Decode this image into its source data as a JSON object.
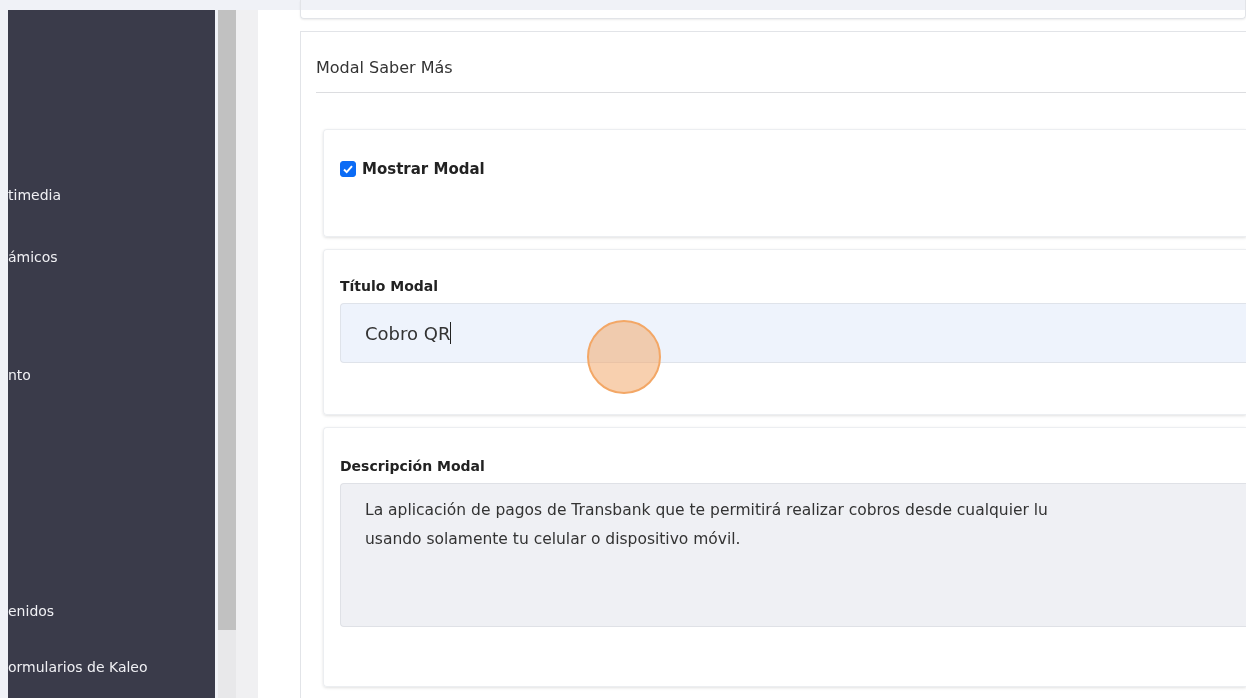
{
  "sidebar": {
    "items": [
      {
        "label": "timedia"
      },
      {
        "label": "ámicos"
      },
      {
        "label": "nto"
      },
      {
        "label": "enidos"
      },
      {
        "label": "ormularios de Kaleo"
      }
    ]
  },
  "section": {
    "title": "Modal Saber Más",
    "show_modal": {
      "label": "Mostrar Modal",
      "checked": true
    },
    "title_field": {
      "label": "Título Modal",
      "value": "Cobro QR"
    },
    "description_field": {
      "label": "Descripción Modal",
      "lines": [
        "La aplicación de pagos de Transbank que te permitirá realizar cobros desde cualquier lu",
        "usando solamente tu celular o dispositivo móvil."
      ]
    }
  }
}
